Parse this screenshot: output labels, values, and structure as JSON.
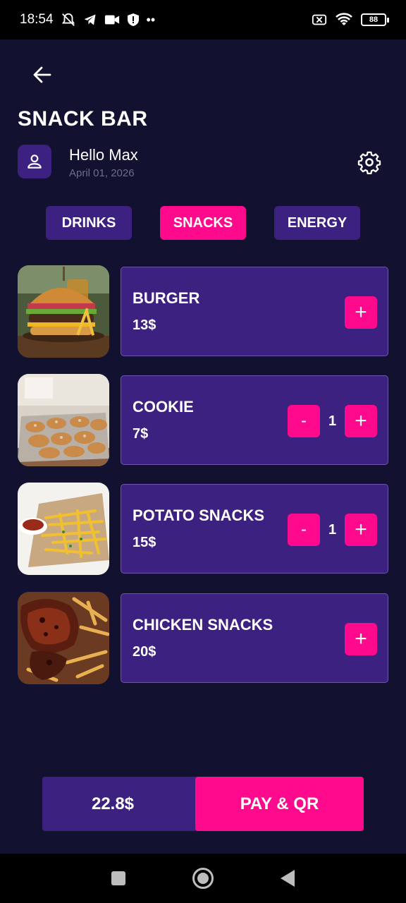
{
  "status": {
    "time": "18:54",
    "battery": "88",
    "icons": [
      "mute-icon",
      "telegram-icon",
      "video-icon",
      "shield-icon",
      "more-dots-icon",
      "sim-off-icon",
      "wifi-icon",
      "battery-icon"
    ]
  },
  "header": {
    "title": "SNACK BAR"
  },
  "user": {
    "greeting": "Hello Max",
    "date": "April 01, 2026"
  },
  "tabs": [
    {
      "label": "DRINKS",
      "active": false
    },
    {
      "label": "SNACKS",
      "active": true
    },
    {
      "label": "ENERGY",
      "active": false
    }
  ],
  "items": [
    {
      "name": "BURGER",
      "price": "13$",
      "qty": null,
      "image": "burger"
    },
    {
      "name": "COOKIE",
      "price": "7$",
      "qty": "1",
      "image": "cookie"
    },
    {
      "name": "POTATO SNACKS",
      "price": "15$",
      "qty": "1",
      "image": "fries"
    },
    {
      "name": "CHICKEN SNACKS",
      "price": "20$",
      "qty": null,
      "image": "chicken"
    }
  ],
  "buttons": {
    "plus": "+",
    "minus": "-"
  },
  "footer": {
    "total": "22.8$",
    "pay_label": "PAY & QR"
  },
  "colors": {
    "background": "#121230",
    "card": "#3d2180",
    "accent": "#ff0a8c"
  }
}
